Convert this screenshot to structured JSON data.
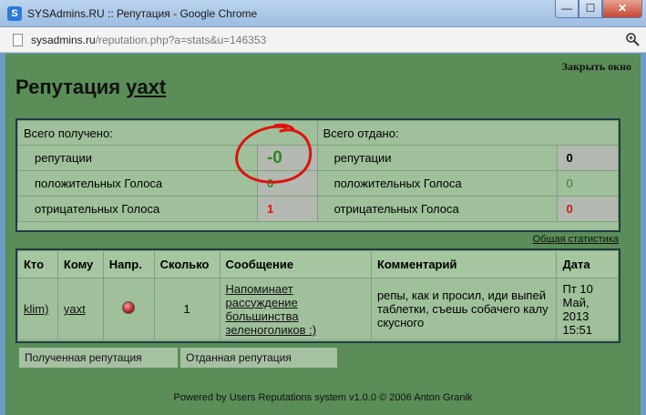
{
  "window": {
    "title": "SYSAdmins.RU :: Репутация - Google Chrome",
    "url_host": "sysadmins.ru",
    "url_path": "/reputation.php?a=stats&u=146353",
    "minimize_glyph": "—",
    "maximize_glyph": "☐",
    "close_glyph": "✕"
  },
  "page": {
    "close_link": "Закрыть окно",
    "title_prefix": "Репутация ",
    "title_user": "yaxt",
    "stats_link": "Общая статистика",
    "footer": "Powered by Users Reputations system v1.0.0 © 2006 Anton Granik"
  },
  "summary": {
    "received_header": "Всего получено:",
    "given_header": "Всего отдано:",
    "rows": [
      {
        "label": "репутации",
        "received": "-0",
        "given_label": "репутации",
        "given": "0"
      },
      {
        "label": "положительных Голоса",
        "received": "0",
        "given_label": "положительных Голоса",
        "given": "0"
      },
      {
        "label": "отрицательных Голоса",
        "received": "1",
        "given_label": "отрицательных Голоса",
        "given": "0"
      }
    ]
  },
  "log": {
    "columns": [
      "Кто",
      "Кому",
      "Напр.",
      "Сколько",
      "Сообщение",
      "Комментарий",
      "Дата"
    ],
    "rows": [
      {
        "who": "klim)",
        "to": "yaxt",
        "direction_icon": "red-dot-icon",
        "amount": "1",
        "message": "Напоминает рассуждение большинства зеленоголиков :)",
        "comment": "репы, как и просил, иди выпей таблетки, съешь собачего калу скусного",
        "date": "Пт 10 Май, 2013 15:51"
      }
    ]
  },
  "tabs": {
    "received": "Полученная репутация",
    "given": "Отданная репутация"
  },
  "colors": {
    "page_bg": "#5a8d57",
    "panel_bg": "#9fc09a",
    "positive": "#2a8a22",
    "negative": "#d21a1a",
    "annotation": "#e01010"
  }
}
